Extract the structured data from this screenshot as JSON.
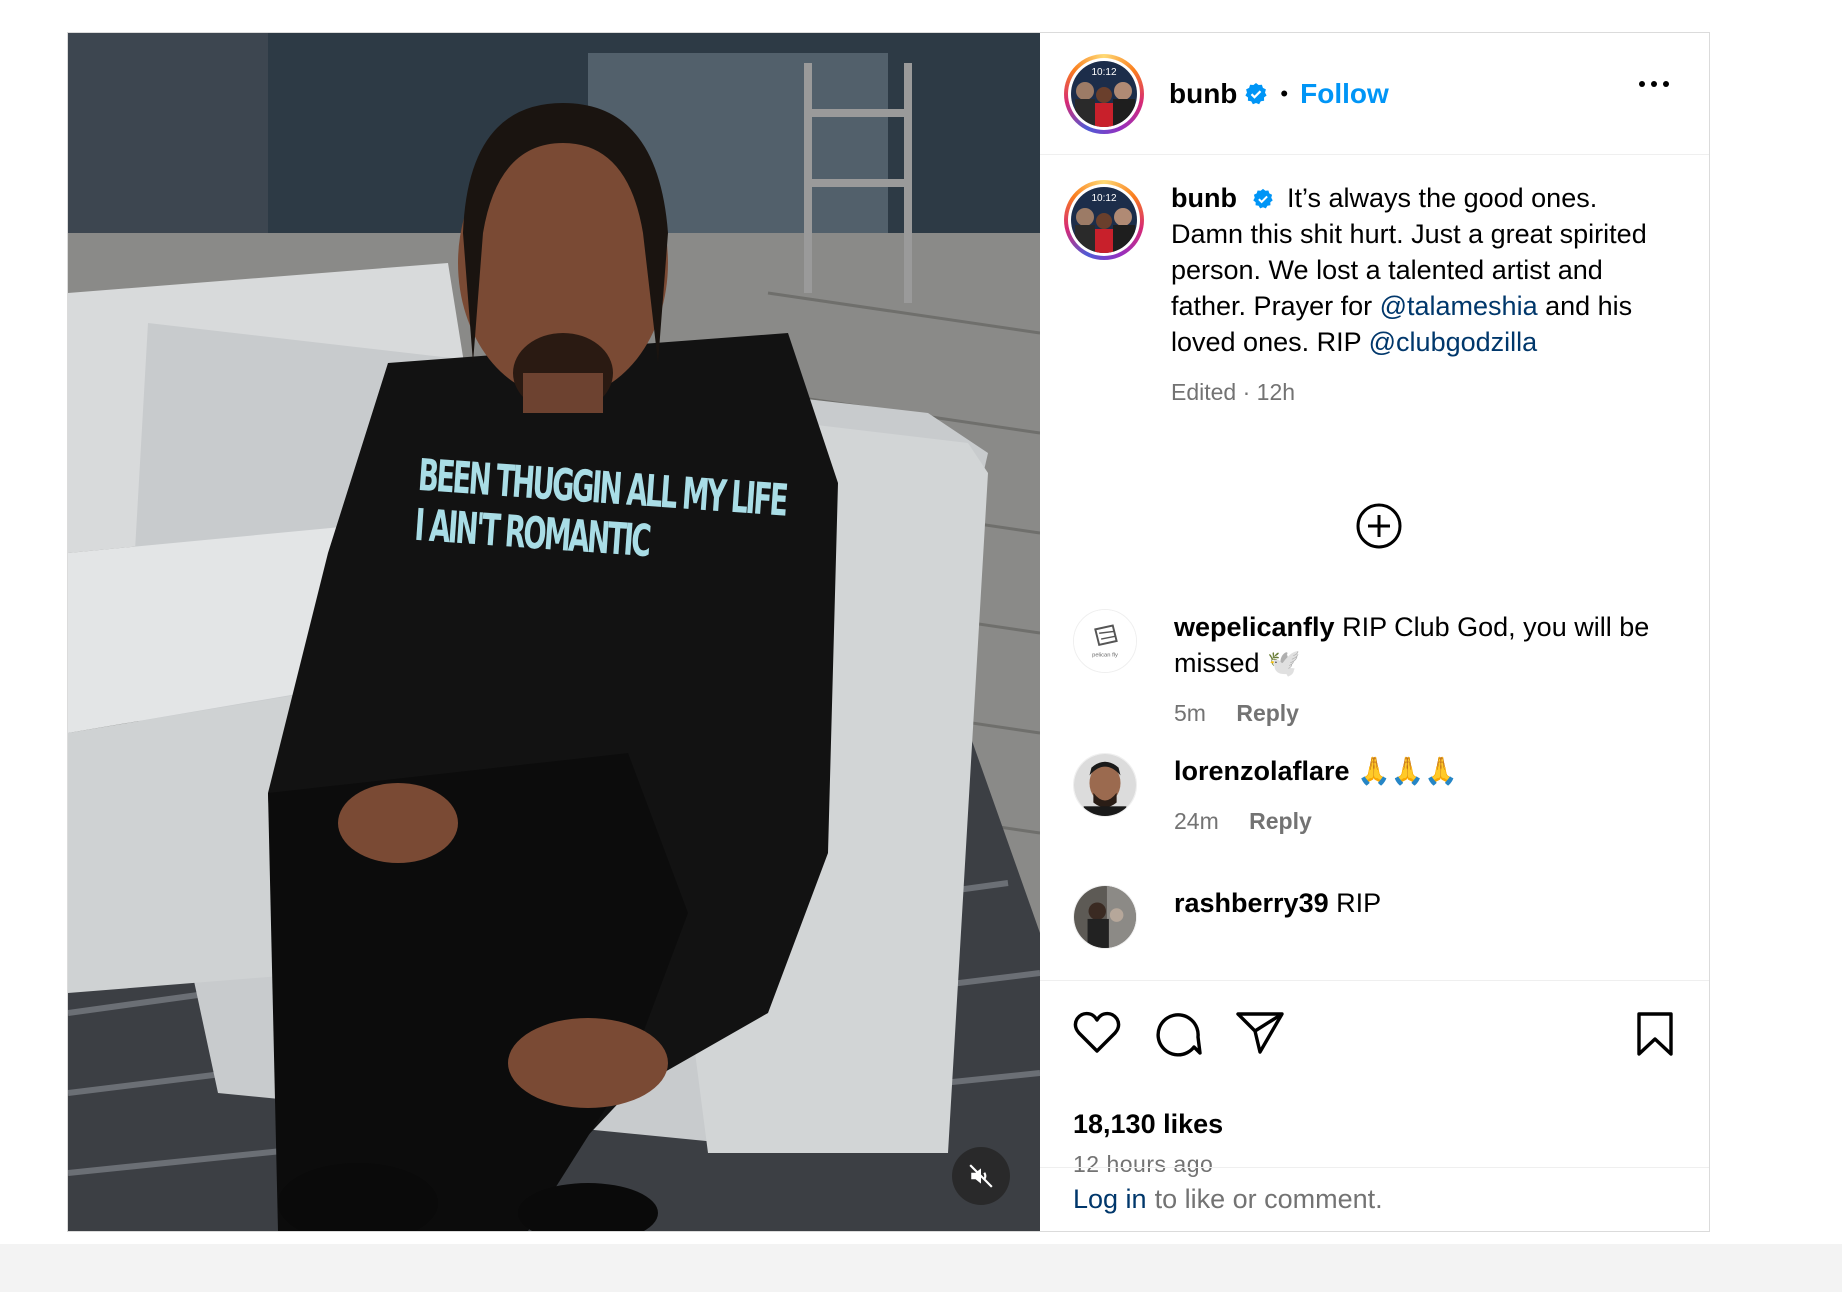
{
  "post": {
    "author": "bunb",
    "follow_label": "Follow",
    "separator": "•",
    "media": {
      "shirt_line1": "BEEN THUGGIN ALL MY LIFE",
      "shirt_line2": "I AIN'T ROMANTIC",
      "avatar_time": "10:12"
    },
    "caption": {
      "username": "bunb",
      "text_part1": "It’s always the good ones. Damn this shit hurt. Just a great spirited person. We lost a talented artist and father. Prayer for",
      "mention1": "@talameshia",
      "text_part2": "and his loved ones. RIP",
      "mention2": "@clubgodzilla",
      "meta": "Edited · 12h"
    },
    "comments": [
      {
        "user": "wepelicanfly",
        "text": "RIP Club God, you will be missed 🕊️",
        "time": "5m",
        "reply": "Reply",
        "avatar_label": "pelican fly"
      },
      {
        "user": "lorenzolaflare",
        "text": "🙏🙏🙏",
        "time": "24m",
        "reply": "Reply"
      },
      {
        "user": "rashberry39",
        "text": "RIP"
      }
    ],
    "likes": "18,130 likes",
    "posted": "12 hours ago",
    "footer": {
      "login": "Log in",
      "rest": "to like or comment."
    }
  },
  "colors": {
    "accent": "#0095f6",
    "link": "#00376b",
    "muted": "#737373"
  }
}
